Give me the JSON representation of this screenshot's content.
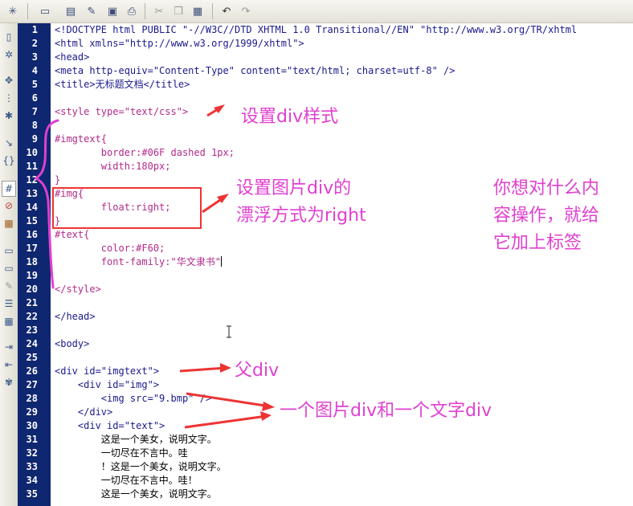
{
  "toolbar": {
    "icons": [
      "new-file-icon",
      "open-folder-icon",
      "browse-icon",
      "edit-icon",
      "save-all-icon",
      "print-icon",
      "cut-icon",
      "copy-icon",
      "paste-icon",
      "undo-icon",
      "redo-icon"
    ]
  },
  "sidebar": {
    "icons": [
      "document-icon",
      "settings-icon",
      "expand-icon",
      "select-tag-icon",
      "balance-icon",
      "collapse-icon",
      "braces-icon",
      "highlight-icon",
      "format-icon",
      "image-icon",
      "comment-icon",
      "comment-add-icon",
      "pencil-icon",
      "list-icon",
      "table-icon",
      "indent-icon",
      "outdent-icon",
      "snippet-icon"
    ]
  },
  "editor": {
    "line_numbers": [
      "1",
      "2",
      "3",
      "4",
      "5",
      "6",
      "7",
      "8",
      "9",
      "10",
      "11",
      "12",
      "13",
      "14",
      "15",
      "16",
      "17",
      "18",
      "19",
      "20",
      "21",
      "22",
      "23",
      "24",
      "25",
      "26",
      "27",
      "28",
      "29",
      "30",
      "31",
      "32",
      "33",
      "34",
      "35"
    ],
    "lines": [
      "<!DOCTYPE html PUBLIC \"-//W3C//DTD XHTML 1.0 Transitional//EN\" \"http://www.w3.org/TR/xhtml",
      "<html xmlns=\"http://www.w3.org/1999/xhtml\">",
      "<head>",
      "<meta http-equiv=\"Content-Type\" content=\"text/html; charset=utf-8\" />",
      "<title>无标题文档</title>",
      "",
      "<style type=\"text/css\">",
      "",
      "#imgtext{",
      "        border:#06F dashed 1px;",
      "        width:180px;",
      "}",
      "#img{",
      "        float:right;",
      "}",
      "#text{",
      "        color:#F60;",
      "        font-family:\"华文隶书\"",
      "",
      "</style>",
      "",
      "</head>",
      "",
      "<body>",
      "",
      "<div id=\"imgtext\">",
      "    <div id=\"img\">",
      "        <img src=\"9.bmp\" />",
      "    </div>",
      "    <div id=\"text\">",
      "        这是一个美女，说明文字。",
      "        一切尽在不言中。哇",
      "        ！这是一个美女，说明文字。",
      "        一切尽在不言中。哇！",
      "        这是一个美女，说明文字。"
    ]
  },
  "annotations": {
    "style_note": "设置div样式",
    "float_note_1": "设置图片div的",
    "float_note_2": "漂浮方式为right",
    "tip_1": "你想对什么内",
    "tip_2": "容操作，就给",
    "tip_3": "它加上标签",
    "parent_note": "父div",
    "children_note": "一个图片div和一个文字div",
    "accent_color": "#e040d0",
    "arrow_color": "#ee3333",
    "box_color": "#ee3333"
  }
}
